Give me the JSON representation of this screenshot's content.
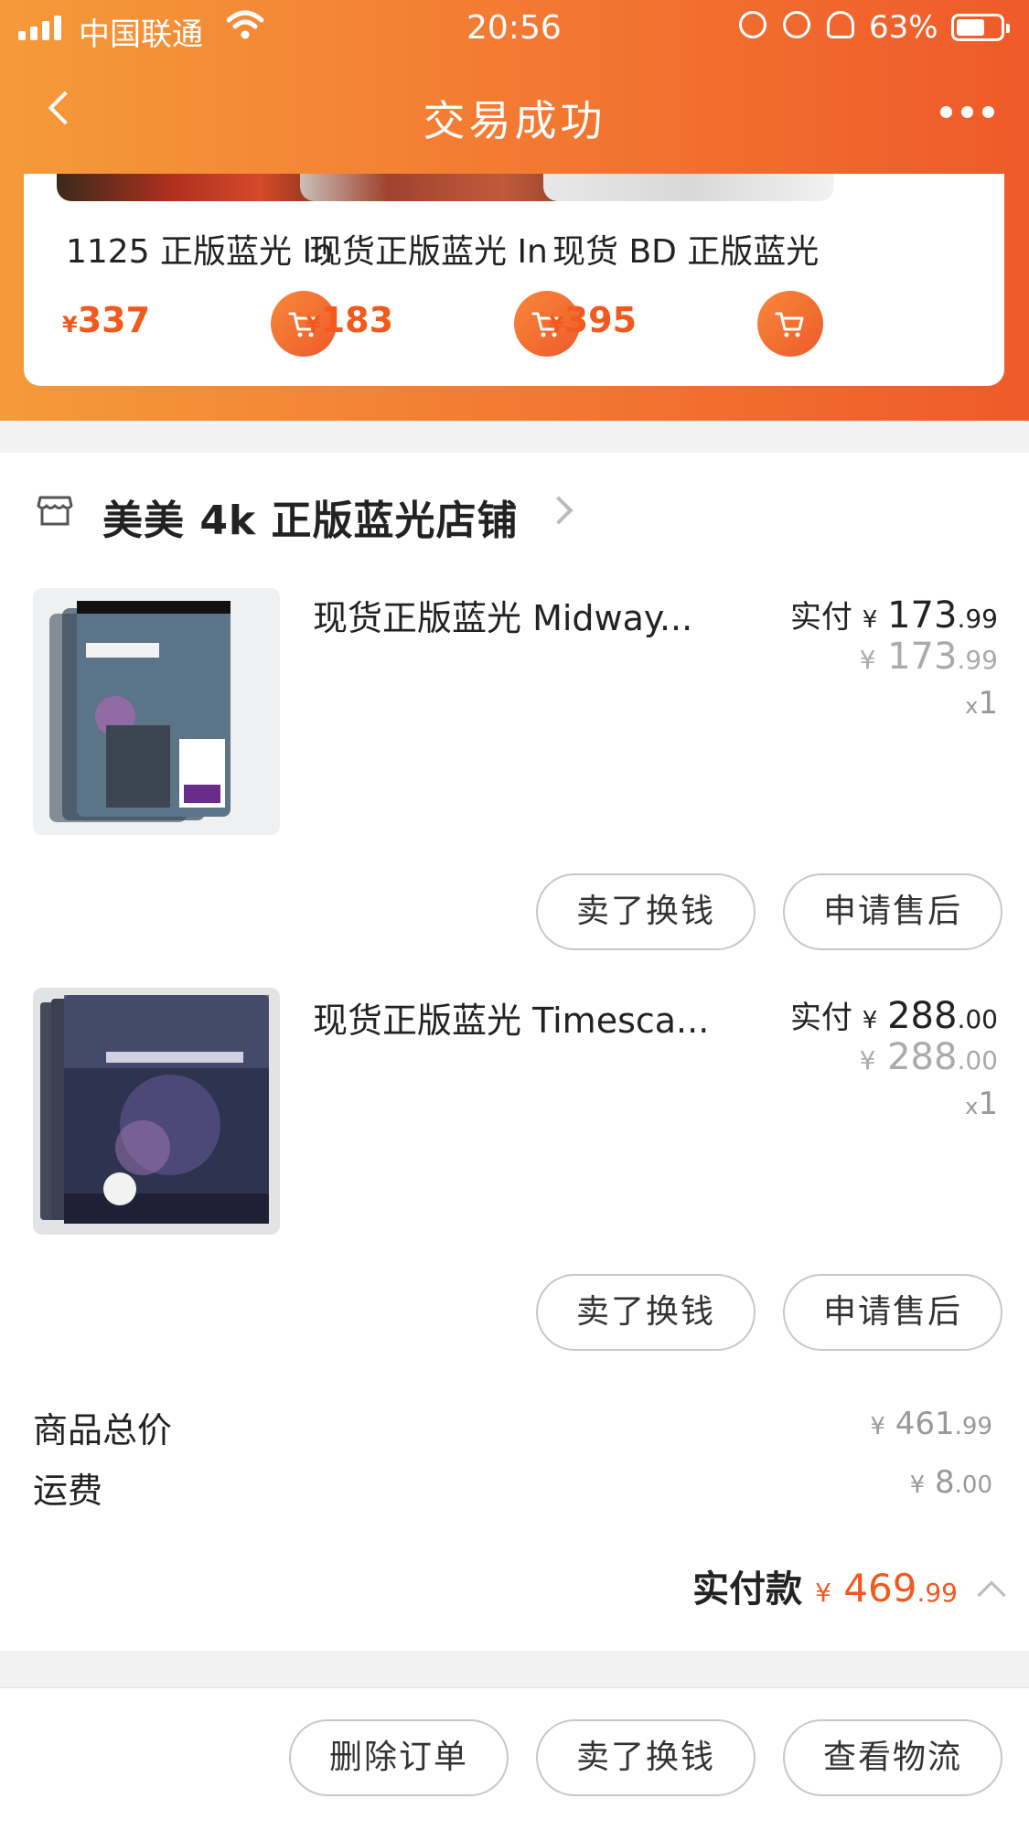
{
  "status_bar": {
    "carrier": "中国联通",
    "time": "20:56",
    "battery": "63%"
  },
  "nav": {
    "title": "交易成功"
  },
  "recommendations": [
    {
      "name": "1125 正版蓝光 In",
      "currency": "¥",
      "price": "337"
    },
    {
      "name": "现货正版蓝光 In",
      "currency": "¥",
      "price": "183"
    },
    {
      "name": "现货 BD 正版蓝光",
      "currency": "¥",
      "price": "395"
    }
  ],
  "shop": {
    "name": "美美 4k 正版蓝光店铺"
  },
  "items": [
    {
      "title": "现货正版蓝光 Midway...",
      "paid_label": "实付",
      "currency": "¥",
      "paid_int": "173",
      "paid_cents": ".99",
      "orig_int": "173",
      "orig_cents": ".99",
      "qty_x": "x",
      "qty": "1",
      "btn_sell": "卖了换钱",
      "btn_after": "申请售后"
    },
    {
      "title": "现货正版蓝光 Timesca...",
      "paid_label": "实付",
      "currency": "¥",
      "paid_int": "288",
      "paid_cents": ".00",
      "orig_int": "288",
      "orig_cents": ".00",
      "qty_x": "x",
      "qty": "1",
      "btn_sell": "卖了换钱",
      "btn_after": "申请售后"
    }
  ],
  "summary": {
    "goods_label": "商品总价",
    "goods_currency": "¥",
    "goods_int": "461",
    "goods_cents": ".99",
    "shipping_label": "运费",
    "shipping_currency": "¥",
    "shipping_int": "8",
    "shipping_cents": ".00",
    "total_label": "实付款",
    "total_currency": "¥",
    "total_int": "469",
    "total_cents": ".99"
  },
  "actions": {
    "delete": "删除订单",
    "sell": "卖了换钱",
    "logistics": "查看物流"
  },
  "colors": {
    "accent": "#f2591e",
    "header_start": "#f59a3a",
    "header_end": "#ef5a2a"
  }
}
